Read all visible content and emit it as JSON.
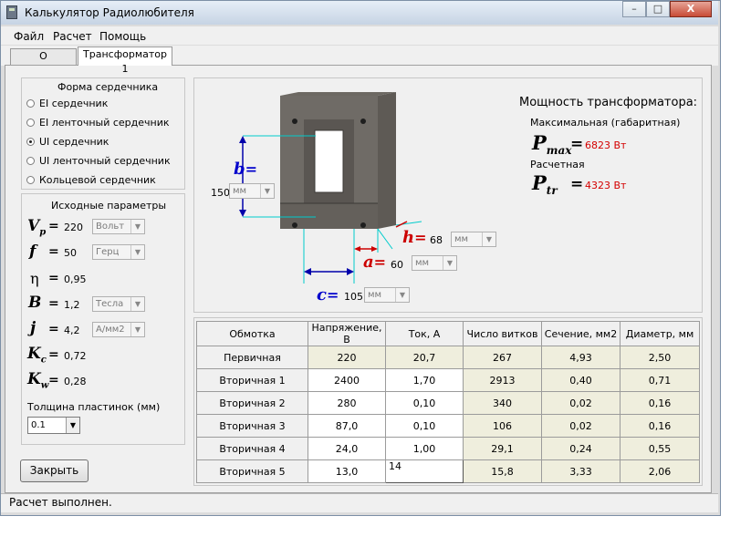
{
  "window": {
    "title": "Калькулятор Радиолюбителя"
  },
  "window_controls": {
    "minimize": "–",
    "maximize": "□",
    "close": "X"
  },
  "menu": [
    "Файл",
    "Расчет",
    "Помощь"
  ],
  "tabs": [
    {
      "label": "О программе",
      "active": false
    },
    {
      "label": "Трансформатор 1",
      "active": true
    }
  ],
  "core": {
    "title": "Форма сердечника",
    "options": [
      {
        "label": "EI сердечник",
        "selected": false
      },
      {
        "label": "EI ленточный сердечник",
        "selected": false
      },
      {
        "label": "UI сердечник",
        "selected": true
      },
      {
        "label": "UI ленточный сердечник",
        "selected": false
      },
      {
        "label": "Кольцевой сердечник",
        "selected": false
      }
    ]
  },
  "params": {
    "title": "Исходные параметры",
    "vp": {
      "value": "220",
      "unit": "Вольт"
    },
    "f": {
      "value": "50",
      "unit": "Герц"
    },
    "eta": {
      "value": "0,95"
    },
    "b": {
      "value": "1,2",
      "unit": "Тесла"
    },
    "j": {
      "value": "4,2",
      "unit": "А/мм2"
    },
    "kc": {
      "value": "0,72"
    },
    "kw": {
      "value": "0,28"
    },
    "thickness_label": "Толщина пластинок (мм)",
    "thickness_value": "0.1"
  },
  "dims": {
    "b": {
      "value": "150",
      "unit": "мм"
    },
    "h": {
      "value": "68",
      "unit": "мм"
    },
    "a": {
      "value": "60",
      "unit": "мм"
    },
    "c": {
      "value": "105",
      "unit": "мм"
    }
  },
  "power": {
    "title": "Мощность трансформатора:",
    "max_label": "Максимальная (габаритная)",
    "max_value": "6823 Вт",
    "calc_label": "Расчетная",
    "calc_value": "4323 Вт"
  },
  "table": {
    "headers": [
      "Обмотка",
      "Напряжение, В",
      "Ток, А",
      "Число витков",
      "Сечение, мм2",
      "Диаметр, мм"
    ],
    "rows": [
      [
        "Первичная",
        "220",
        "20,7",
        "267",
        "4,93",
        "2,50"
      ],
      [
        "Вторичная 1",
        "2400",
        "1,70",
        "2913",
        "0,40",
        "0,71"
      ],
      [
        "Вторичная 2",
        "280",
        "0,10",
        "340",
        "0,02",
        "0,16"
      ],
      [
        "Вторичная 3",
        "87,0",
        "0,10",
        "106",
        "0,02",
        "0,16"
      ],
      [
        "Вторичная 4",
        "24,0",
        "1,00",
        "29,1",
        "0,24",
        "0,55"
      ],
      [
        "Вторичная 5",
        "13,0",
        "14",
        "15,8",
        "3,33",
        "2,06"
      ]
    ]
  },
  "close_button": "Закрыть",
  "status": "Расчет выполнен."
}
